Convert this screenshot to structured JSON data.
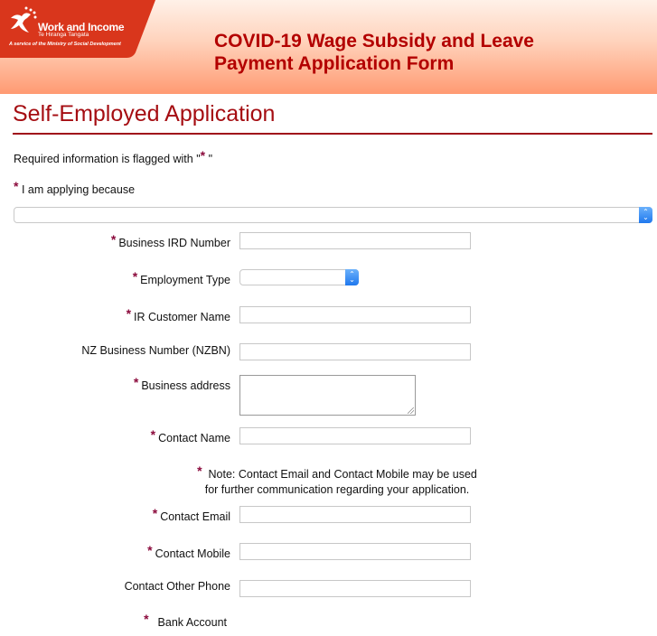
{
  "header": {
    "brand_name": "Work and Income",
    "brand_subtitle": "Te Hiranga Tangata",
    "brand_tagline": "A service of the Ministry of Social Development",
    "title_line1": "COVID-19 Wage Subsidy and Leave",
    "title_line2": "Payment Application Form"
  },
  "colors": {
    "brand_red": "#d9361c",
    "title_red": "#b30000",
    "required_star": "#8b0a3c",
    "select_blue": "#1f78ee"
  },
  "form": {
    "section_title": "Self-Employed Application",
    "required_note_prefix": "Required information is flagged with \"",
    "required_note_suffix": " \"",
    "required_marker": "*",
    "applying_because": {
      "label": "I am applying because",
      "value": ""
    },
    "fields": {
      "business_ird": {
        "label": "Business IRD Number",
        "value": "",
        "required": true
      },
      "employment_type": {
        "label": "Employment Type",
        "value": "",
        "required": true
      },
      "ir_customer_name": {
        "label": "IR Customer Name",
        "value": "",
        "required": true
      },
      "nzbn": {
        "label": "NZ Business Number (NZBN)",
        "value": "",
        "required": false
      },
      "business_address": {
        "label": "Business address",
        "value": "",
        "required": true
      },
      "contact_name": {
        "label": "Contact Name",
        "value": "",
        "required": true
      },
      "contact_email": {
        "label": "Contact Email",
        "value": "",
        "required": true
      },
      "contact_mobile": {
        "label": "Contact Mobile",
        "value": "",
        "required": true
      },
      "contact_other_phone": {
        "label": "Contact Other Phone",
        "value": "",
        "required": false
      },
      "bank_account": {
        "label": "Bank Account",
        "required": true
      }
    },
    "contact_note_line1": "Note: Contact Email and Contact Mobile may be used",
    "contact_note_line2": "for further communication regarding your application."
  }
}
